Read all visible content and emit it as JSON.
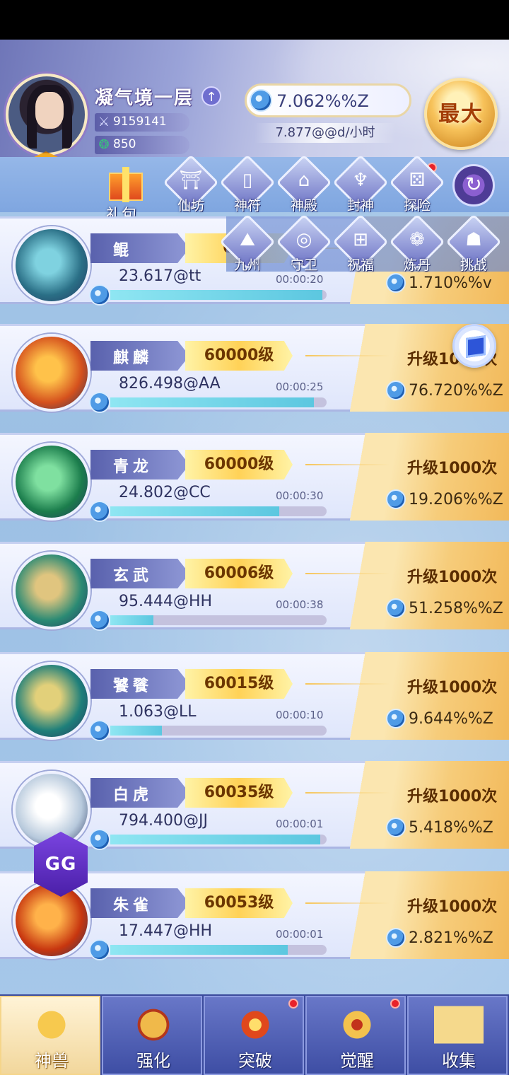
{
  "header": {
    "player_name": "凝气境一层",
    "combat_power": "9159141",
    "currency": "850",
    "speed": "7.062%%Z",
    "rate": "7.877@@d/小时",
    "max_label": "最大"
  },
  "menu": {
    "gift_label": "礼包",
    "row1": [
      "仙坊",
      "神符",
      "神殿",
      "封神",
      "探险"
    ],
    "row2": [
      "九州",
      "守卫",
      "祝福",
      "炼丹",
      "挑战"
    ]
  },
  "beasts": [
    {
      "name": "鲲",
      "level": "600",
      "amount": "23.617@tt",
      "timer": "00:00:20",
      "upgrade": "",
      "percent": "1.710%%v",
      "progress": 0.98,
      "colors": [
        "#2a6f86",
        "#7fd2e0"
      ]
    },
    {
      "name": "麒麟",
      "level": "60000级",
      "amount": "826.498@AA",
      "timer": "00:00:25",
      "upgrade": "升级1000次",
      "percent": "76.720%%Z",
      "progress": 0.94,
      "colors": [
        "#d5511d",
        "#ffc24a"
      ]
    },
    {
      "name": "青龙",
      "level": "60000级",
      "amount": "24.802@CC",
      "timer": "00:00:30",
      "upgrade": "升级1000次",
      "percent": "19.206%%Z",
      "progress": 0.78,
      "colors": [
        "#1b7d4c",
        "#7fe0a0"
      ]
    },
    {
      "name": "玄武",
      "level": "60006级",
      "amount": "95.444@HH",
      "timer": "00:00:38",
      "upgrade": "升级1000次",
      "percent": "51.258%%Z",
      "progress": 0.2,
      "colors": [
        "#2a8a74",
        "#e0c57f"
      ]
    },
    {
      "name": "饕餮",
      "level": "60015级",
      "amount": "1.063@LL",
      "timer": "00:00:10",
      "upgrade": "升级1000次",
      "percent": "9.644%%Z",
      "progress": 0.24,
      "colors": [
        "#1e7f7a",
        "#e2d07a"
      ]
    },
    {
      "name": "白虎",
      "level": "60035级",
      "amount": "794.400@JJ",
      "timer": "00:00:01",
      "upgrade": "升级1000次",
      "percent": "5.418%%Z",
      "progress": 0.97,
      "colors": [
        "#b7c9dc",
        "#ffffff"
      ]
    },
    {
      "name": "朱雀",
      "level": "60053级",
      "amount": "17.447@HH",
      "timer": "00:00:01",
      "upgrade": "升级1000次",
      "percent": "2.821%%Z",
      "progress": 0.82,
      "colors": [
        "#c7360f",
        "#ffb24a"
      ]
    }
  ],
  "floating": {
    "gg_label": "GG"
  },
  "nav": {
    "tabs": [
      "神兽",
      "强化",
      "突破",
      "觉醒",
      "收集"
    ]
  }
}
